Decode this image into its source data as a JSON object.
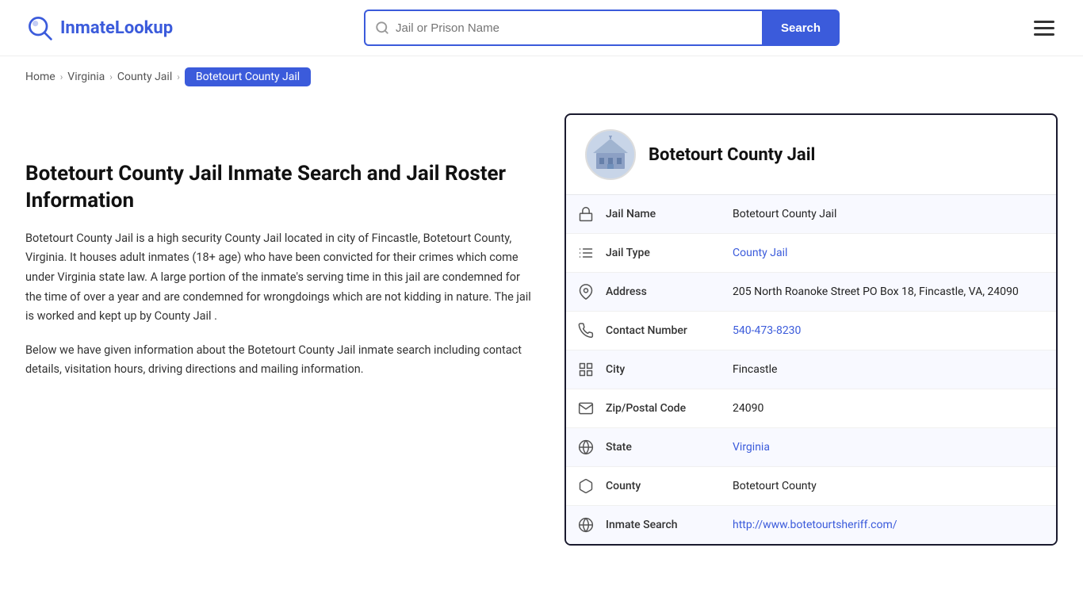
{
  "logo": {
    "text_part1": "Inmate",
    "text_part2": "Lookup",
    "alt": "InmateLookup"
  },
  "search": {
    "placeholder": "Jail or Prison Name",
    "button_label": "Search"
  },
  "breadcrumb": {
    "items": [
      {
        "label": "Home",
        "href": "#"
      },
      {
        "label": "Virginia",
        "href": "#"
      },
      {
        "label": "County Jail",
        "href": "#"
      },
      {
        "label": "Botetourt County Jail",
        "current": true
      }
    ]
  },
  "left": {
    "title": "Botetourt County Jail Inmate Search and Jail Roster Information",
    "description1": "Botetourt County Jail is a high security County Jail located in city of Fincastle, Botetourt County, Virginia. It houses adult inmates (18+ age) who have been convicted for their crimes which come under Virginia state law. A large portion of the inmate's serving time in this jail are condemned for the time of over a year and are condemned for wrongdoings which are not kidding in nature. The jail is worked and kept up by County Jail .",
    "description2": "Below we have given information about the Botetourt County Jail inmate search including contact details, visitation hours, driving directions and mailing information."
  },
  "card": {
    "jail_name": "Botetourt County Jail",
    "rows": [
      {
        "icon": "jail-icon",
        "label": "Jail Name",
        "value": "Botetourt County Jail",
        "link": null
      },
      {
        "icon": "type-icon",
        "label": "Jail Type",
        "value": "County Jail",
        "link": "#"
      },
      {
        "icon": "location-icon",
        "label": "Address",
        "value": "205 North Roanoke Street PO Box 18, Fincastle, VA, 24090",
        "link": null
      },
      {
        "icon": "phone-icon",
        "label": "Contact Number",
        "value": "540-473-8230",
        "link": "tel:5404738230"
      },
      {
        "icon": "city-icon",
        "label": "City",
        "value": "Fincastle",
        "link": null
      },
      {
        "icon": "zip-icon",
        "label": "Zip/Postal Code",
        "value": "24090",
        "link": null
      },
      {
        "icon": "state-icon",
        "label": "State",
        "value": "Virginia",
        "link": "#"
      },
      {
        "icon": "county-icon",
        "label": "County",
        "value": "Botetourt County",
        "link": null
      },
      {
        "icon": "search-icon",
        "label": "Inmate Search",
        "value": "http://www.botetourtsheriff.com/",
        "link": "http://www.botetourtsheriff.com/"
      }
    ]
  }
}
